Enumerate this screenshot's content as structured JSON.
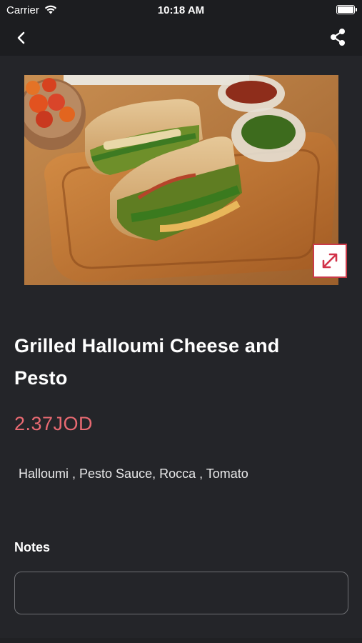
{
  "status_bar": {
    "carrier": "Carrier",
    "time": "10:18 AM"
  },
  "nav": {
    "back_icon": "chevron-left-icon",
    "share_icon": "share-icon"
  },
  "product": {
    "image_alt": "Grilled Halloumi Cheese and Pesto sandwich on wooden board",
    "title": "Grilled Halloumi Cheese and Pesto",
    "price": "2.37JOD",
    "ingredients": "Halloumi , Pesto Sauce, Rocca , Tomato",
    "expand_icon": "expand-icon"
  },
  "notes": {
    "label": "Notes",
    "value": "",
    "placeholder": ""
  },
  "colors": {
    "background": "#242529",
    "header": "#1c1d20",
    "price": "#e96a72",
    "accent": "#c93a49"
  }
}
